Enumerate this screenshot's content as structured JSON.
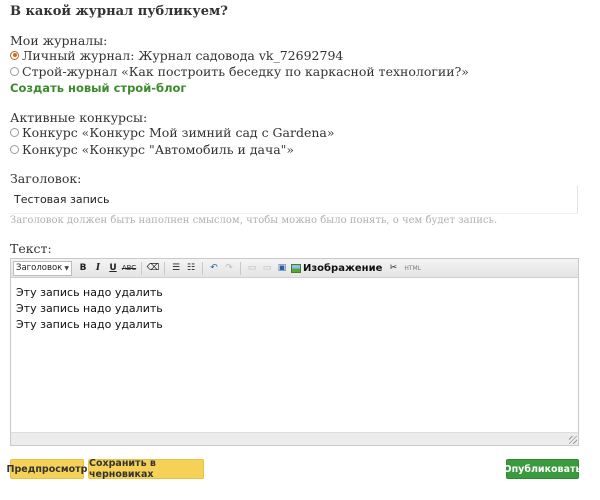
{
  "form": {
    "heading": "В какой журнал публикуем?",
    "my_journals_label": "Мои журналы:",
    "journals": [
      {
        "label": "Личный журнал: Журнал садовода vk_72692794",
        "selected": true
      },
      {
        "label": "Строй-журнал «Как построить беседку по каркасной технологии?»",
        "selected": false
      }
    ],
    "create_blog_link": "Создать новый строй-блог",
    "contests_label": "Активные конкурсы:",
    "contests": [
      {
        "label": "Конкурс «Конкурс Мой зимний сад с Gardena»",
        "selected": false
      },
      {
        "label": "Конкурс «Конкурс \"Автомобиль и дача\"»",
        "selected": false
      }
    ],
    "title_label": "Заголовок:",
    "title_value": "Тестовая запись",
    "title_hint": "Заголовок должен быть наполнен смыслом, чтобы можно было понять, о чем будет запись.",
    "text_label": "Текст:"
  },
  "editor": {
    "format_select": "Заголовок",
    "toolbar": {
      "bold": "B",
      "italic": "I",
      "underline": "U",
      "strike": "ABC",
      "eraser": "⌫",
      "bullet_list": "☰",
      "numbered_list": "☷",
      "undo": "↶",
      "redo": "↷",
      "link": "▭",
      "unlink": "▭",
      "save": "▣",
      "image": "Изображение",
      "cut": "✂",
      "html": "HTML"
    },
    "lines": [
      "Эту запись надо удалить",
      "Эту запись надо удалить",
      "Эту запись надо удалить"
    ]
  },
  "actions": {
    "preview": "Предпросмотр",
    "save_draft": "Сохранить в черновиках",
    "publish": "Опубликовать"
  },
  "colors": {
    "link_green": "#3c8a2e",
    "button_yellow": "#f5d257",
    "button_green": "#3a9a3e",
    "radio_checked": "#d2691e"
  }
}
